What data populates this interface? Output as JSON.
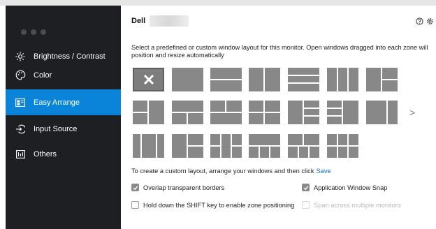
{
  "sidebar": {
    "items": [
      {
        "label": "Brightness / Contrast",
        "icon": "sun-icon",
        "active": false
      },
      {
        "label": "Color",
        "icon": "palette-icon",
        "active": false
      },
      {
        "label": "Easy Arrange",
        "icon": "layout-icon",
        "active": true
      },
      {
        "label": "Input Source",
        "icon": "input-icon",
        "active": false
      },
      {
        "label": "Others",
        "icon": "others-icon",
        "active": false
      }
    ]
  },
  "header": {
    "title": "Dell",
    "icons": [
      "help-icon",
      "settings-icon"
    ]
  },
  "main": {
    "description": "Select a predefined or custom window layout for this monitor.  Open windows dragged into each zone will position and resize automatically",
    "more_arrow": ">",
    "custom_hint": "To create a custom layout, arrange your windows and then click",
    "save_label": "Save",
    "options": [
      {
        "label": "Overlap transparent borders",
        "checked": true,
        "disabled": false
      },
      {
        "label": "Application Window Snap",
        "checked": true,
        "disabled": false
      },
      {
        "label": "Hold down the SHIFT key to enable zone positioning",
        "checked": false,
        "disabled": false
      },
      {
        "label": "Span across multiple monitors",
        "checked": false,
        "disabled": true
      }
    ]
  },
  "colors": {
    "sidebar_bg": "#1e1f22",
    "accent": "#0a84d8",
    "layout_gray": "#888888",
    "link": "#0a6fd1"
  }
}
